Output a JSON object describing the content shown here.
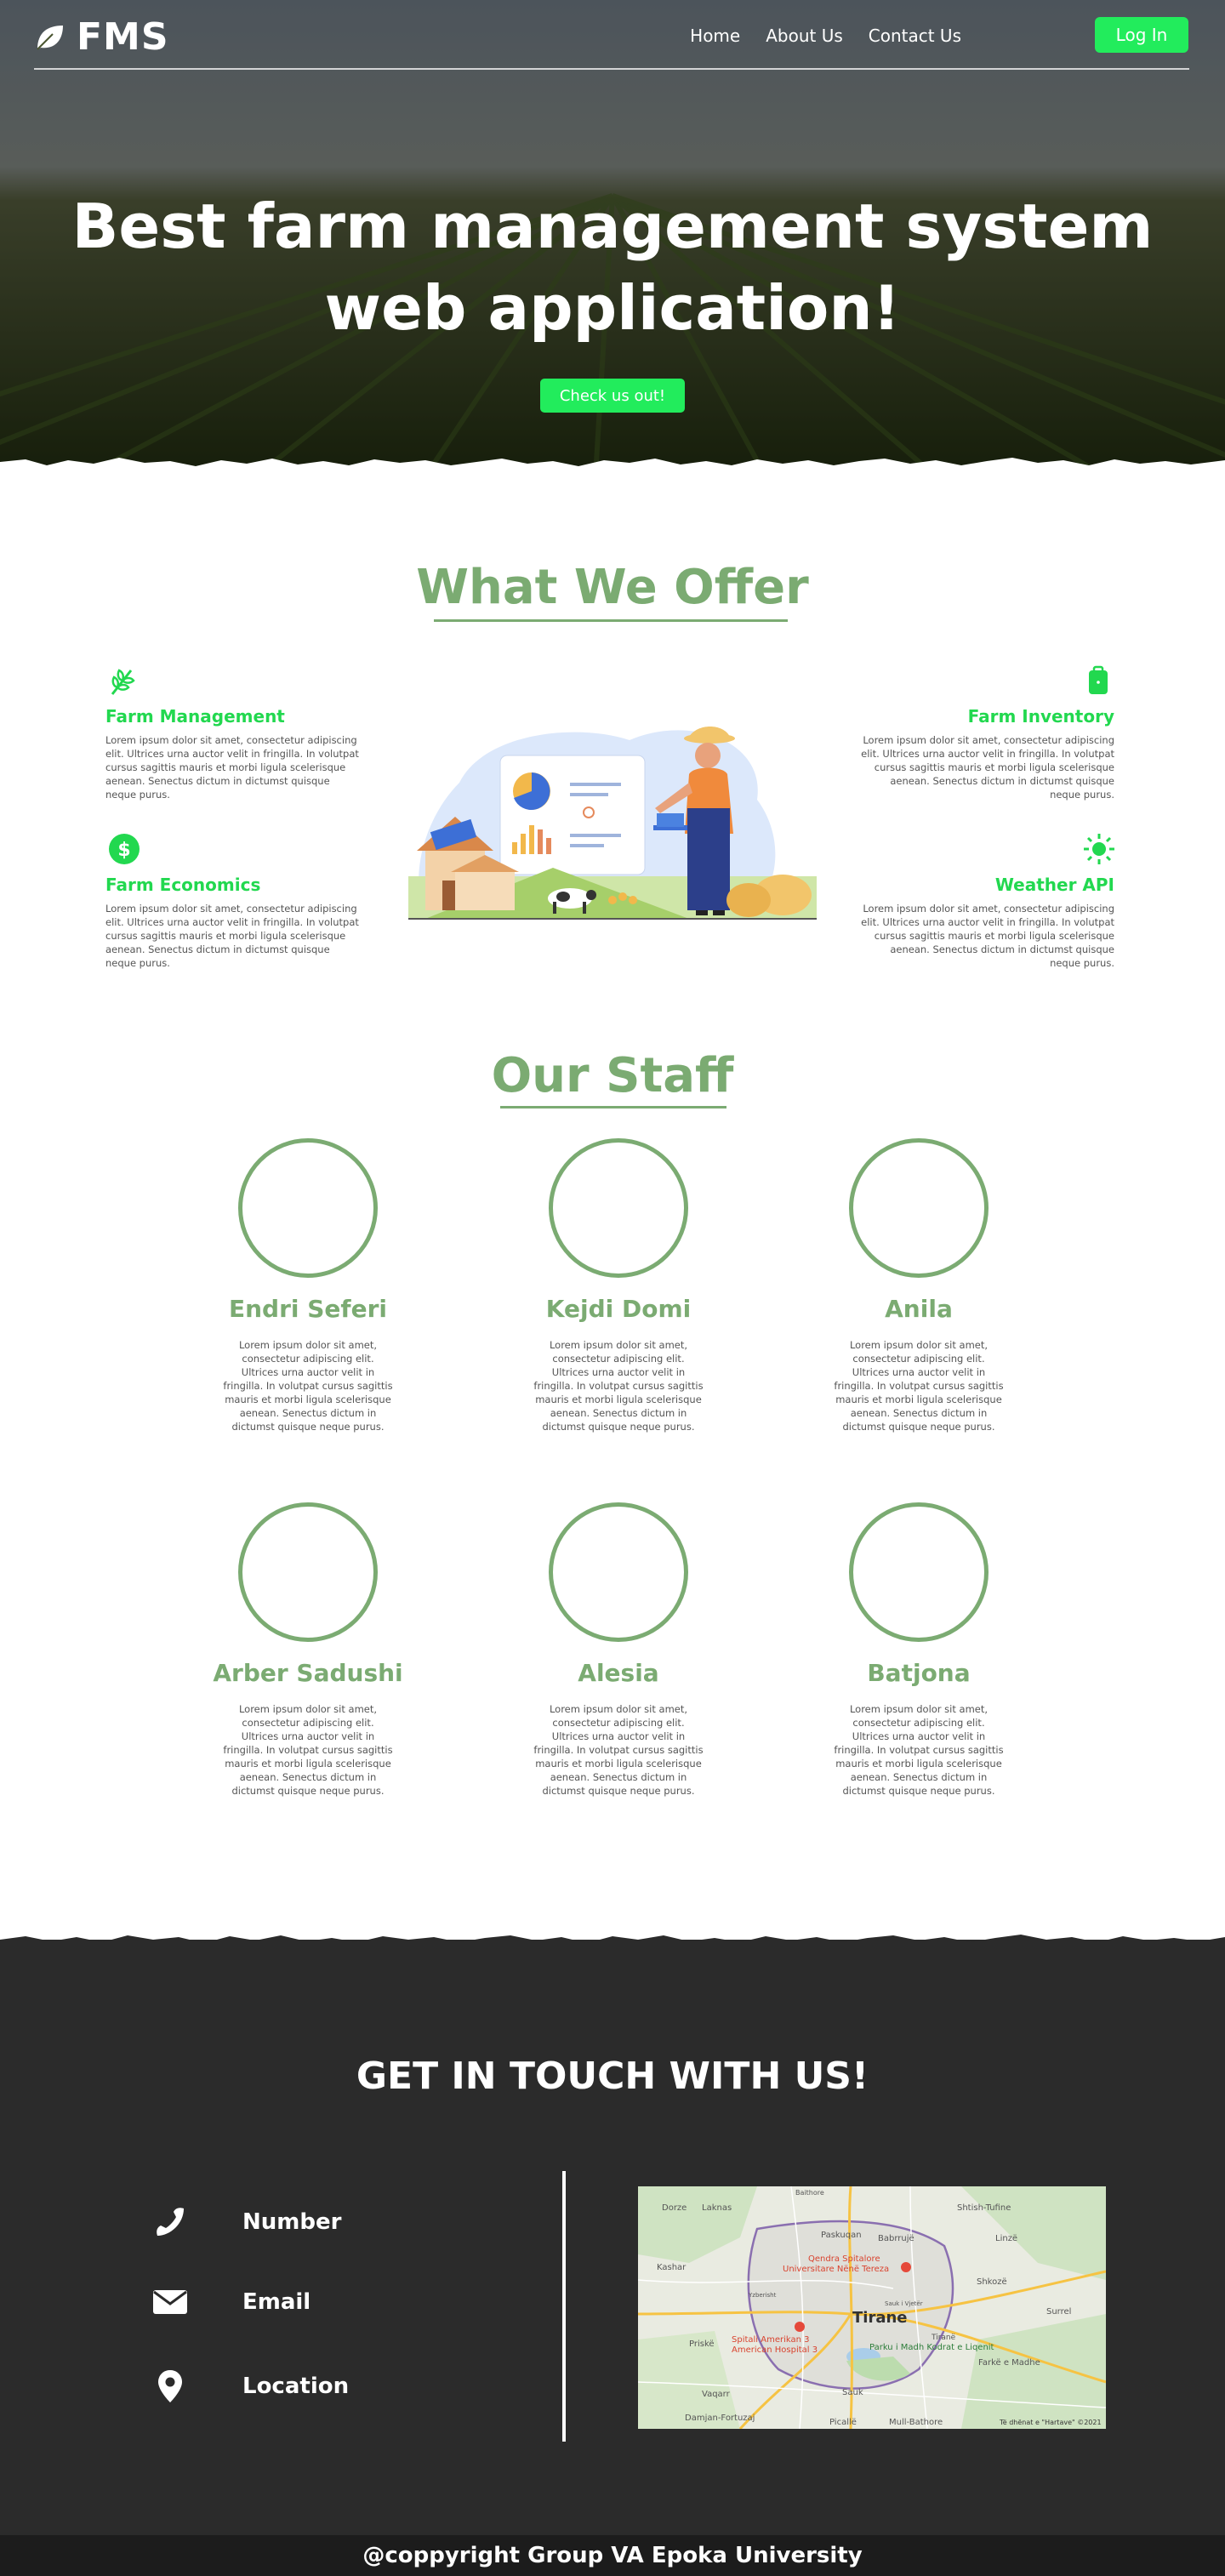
{
  "nav": {
    "logo_text": "FMS",
    "links": [
      "Home",
      "About Us",
      "Contact Us"
    ],
    "login_label": "Log In"
  },
  "hero": {
    "title_line1": "Best farm management system",
    "title_line2": "web application!",
    "cta_label": "Check us out!"
  },
  "offers": {
    "title": "What We Offer",
    "items": [
      {
        "title": "Farm Management",
        "icon": "wheat-icon",
        "text": "Lorem ipsum dolor sit amet, consectetur adipiscing elit. Ultrices urna auctor velit in fringilla. In volutpat cursus sagittis mauris et morbi ligula scelerisque aenean. Senectus dictum in dictumst quisque neque purus."
      },
      {
        "title": "Farm Inventory",
        "icon": "backpack-icon",
        "text": "Lorem ipsum dolor sit amet, consectetur adipiscing elit. Ultrices urna auctor velit in fringilla. In volutpat cursus sagittis mauris et morbi ligula scelerisque aenean. Senectus dictum in dictumst quisque neque purus."
      },
      {
        "title": "Farm Economics",
        "icon": "dollar-icon",
        "text": "Lorem ipsum dolor sit amet, consectetur adipiscing elit. Ultrices urna auctor velit in fringilla. In volutpat cursus sagittis mauris et morbi ligula scelerisque aenean. Senectus dictum in dictumst quisque neque purus."
      },
      {
        "title": "Weather API",
        "icon": "sun-icon",
        "text": "Lorem ipsum dolor sit amet, consectetur adipiscing elit. Ultrices urna auctor velit in fringilla. In volutpat cursus sagittis mauris et morbi ligula scelerisque aenean. Senectus dictum in dictumst quisque neque purus."
      }
    ]
  },
  "staff": {
    "title": "Our Staff",
    "members": [
      {
        "name": "Endri Seferi",
        "text": "Lorem ipsum dolor sit amet, consectetur adipiscing elit. Ultrices urna auctor velit in fringilla. In volutpat cursus sagittis mauris et morbi ligula scelerisque aenean. Senectus dictum in dictumst quisque neque purus."
      },
      {
        "name": "Kejdi Domi",
        "text": "Lorem ipsum dolor sit amet, consectetur adipiscing elit. Ultrices urna auctor velit in fringilla. In volutpat cursus sagittis mauris et morbi ligula scelerisque aenean. Senectus dictum in dictumst quisque neque purus."
      },
      {
        "name": "Anila",
        "text": "Lorem ipsum dolor sit amet, consectetur adipiscing elit. Ultrices urna auctor velit in fringilla. In volutpat cursus sagittis mauris et morbi ligula scelerisque aenean. Senectus dictum in dictumst quisque neque purus."
      },
      {
        "name": "Arber Sadushi",
        "text": "Lorem ipsum dolor sit amet, consectetur adipiscing elit. Ultrices urna auctor velit in fringilla. In volutpat cursus sagittis mauris et morbi ligula scelerisque aenean. Senectus dictum in dictumst quisque neque purus."
      },
      {
        "name": "Alesia",
        "text": "Lorem ipsum dolor sit amet, consectetur adipiscing elit. Ultrices urna auctor velit in fringilla. In volutpat cursus sagittis mauris et morbi ligula scelerisque aenean. Senectus dictum in dictumst quisque neque purus."
      },
      {
        "name": "Batjona",
        "text": "Lorem ipsum dolor sit amet, consectetur adipiscing elit. Ultrices urna auctor velit in fringilla. In volutpat cursus sagittis mauris et morbi ligula scelerisque aenean. Senectus dictum in dictumst quisque neque purus."
      }
    ]
  },
  "contact": {
    "title": "GET IN TOUCH WITH US!",
    "items": [
      {
        "label": "Number",
        "icon": "phone-icon"
      },
      {
        "label": "Email",
        "icon": "envelope-icon"
      },
      {
        "label": "Location",
        "icon": "map-pin-icon"
      }
    ],
    "map": {
      "city": "Tirane",
      "labels": [
        "Dorze",
        "Laknas",
        "Baithore",
        "Shtish-Tufine",
        "Paskuqan",
        "Babrrujë",
        "Linzë",
        "Kashar",
        "Qendra Spitalore",
        "Universitare Nënë Tereza",
        "Shkozë",
        "Yzberisht",
        "Sauk i Vjetër",
        "Spitali Amerikan 3",
        "American Hospital 3",
        "Parku i Madh Kodrat e Liqenit",
        "Farkë e Madhe",
        "Vaqarr",
        "Sauk",
        "Damjan-Fortuzaj",
        "Picallë",
        "Mull-Bathore",
        "Surrel",
        "Priskë",
        "Tiranë"
      ],
      "attribution": "Të dhënat e \"Hartave\" ©2021"
    }
  },
  "footer": {
    "text": "@coppyright Group VA Epoka University"
  },
  "colors": {
    "accent_green": "#22ec5c",
    "heading_green": "#7bab72",
    "dark_bg": "#2b2b2b"
  }
}
